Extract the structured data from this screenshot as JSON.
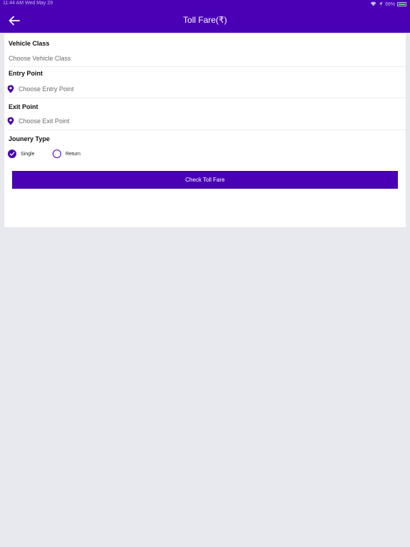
{
  "status_bar": {
    "time": "11:44 AM   Wed May 29",
    "battery": "99%"
  },
  "header": {
    "title": "Toll Fare(₹)"
  },
  "form": {
    "vehicle_class": {
      "label": "Vehicle Class",
      "placeholder": "Choose Vehicle Class"
    },
    "entry_point": {
      "label": "Entry Point",
      "placeholder": "Choose Entry Point"
    },
    "exit_point": {
      "label": "Exit Point",
      "placeholder": "Choose Exit Point"
    },
    "journey_type": {
      "label": "Jounery Type",
      "options": [
        {
          "label": "Single",
          "selected": true
        },
        {
          "label": "Return",
          "selected": false
        }
      ]
    },
    "submit_label": "Check Toll Fare"
  },
  "colors": {
    "primary": "#4a00b5",
    "background": "#e8e9ee",
    "card": "#ffffff"
  }
}
